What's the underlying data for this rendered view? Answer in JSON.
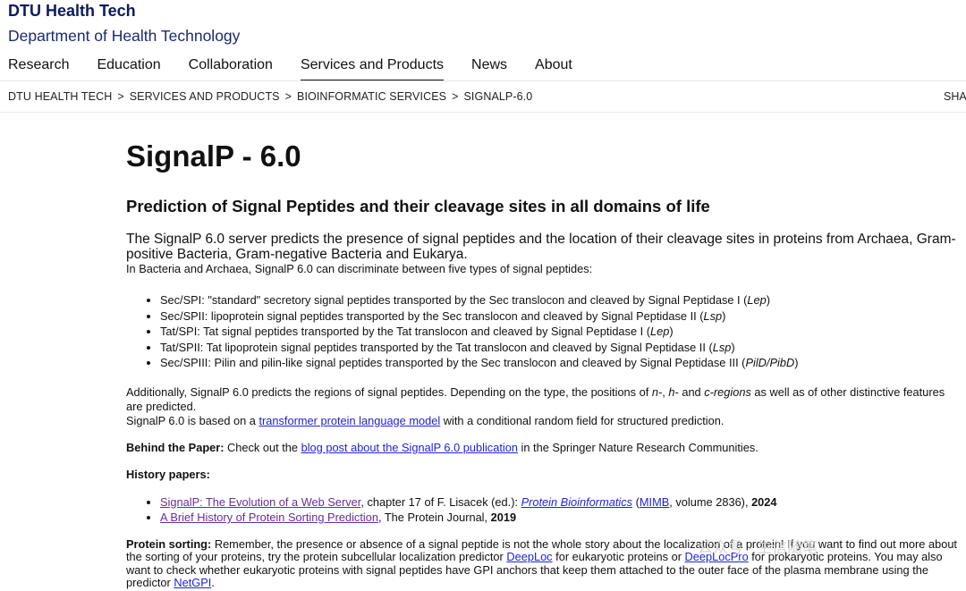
{
  "header": {
    "brand_title": "DTU Health Tech",
    "brand_subtitle": "Department of Health Technology"
  },
  "nav": {
    "items": [
      {
        "label": "Research"
      },
      {
        "label": "Education"
      },
      {
        "label": "Collaboration"
      },
      {
        "label": "Services and Products",
        "active": true
      },
      {
        "label": "News"
      },
      {
        "label": "About"
      }
    ]
  },
  "breadcrumb": {
    "items": [
      "DTU HEALTH TECH",
      "SERVICES AND PRODUCTS",
      "BIOINFORMATIC SERVICES",
      "SIGNALP-6.0"
    ],
    "separator": ">",
    "share_label": "SHA"
  },
  "page": {
    "title": "SignalP - 6.0",
    "subtitle": "Prediction of Signal Peptides and their cleavage sites in all domains of life",
    "lead": "The SignalP 6.0 server predicts the presence of signal peptides and the location of their cleavage sites in proteins from Archaea, Gram-positive Bacteria, Gram-negative Bacteria and Eukarya.",
    "intro": "In Bacteria and Archaea, SignalP 6.0 can discriminate between five types of signal peptides:",
    "types": [
      {
        "text": "Sec/SPI: \"standard\" secretory signal peptides transported by the Sec translocon and cleaved by Signal Peptidase I (",
        "italic": "Lep",
        "end": ")"
      },
      {
        "text": "Sec/SPII: lipoprotein signal peptides transported by the Sec translocon and cleaved by Signal Peptidase II (",
        "italic": "Lsp",
        "end": ")"
      },
      {
        "text": "Tat/SPI: Tat signal peptides transported by the Tat translocon and cleaved by Signal Peptidase I (",
        "italic": "Lep",
        "end": ")"
      },
      {
        "text": "Tat/SPII: Tat lipoprotein signal peptides transported by the Tat translocon and cleaved by Signal Peptidase II (",
        "italic": "Lsp",
        "end": ")"
      },
      {
        "text": "Sec/SPIII: Pilin and pilin-like signal peptides transported by the Sec translocon and cleaved by Signal Peptidase III (",
        "italic": "PilD/PibD",
        "end": ")"
      }
    ],
    "additionally": {
      "pre": "Additionally, SignalP 6.0 predicts the regions of signal peptides. Depending on the type, the positions of ",
      "n": "n-",
      "c1": ", ",
      "h": "h-",
      "c2": " and ",
      "c": "c-regions",
      "post": " as well as of other distinctive features are predicted."
    },
    "based": {
      "pre": "SignalP 6.0 is based on a ",
      "link": "transformer protein language model",
      "post": " with a conditional random field for structured prediction."
    },
    "behind": {
      "label": "Behind the Paper:",
      "pre": " Check out the ",
      "link": "blog post about the SignalP 6.0 publication",
      "post": " in the Springer Nature Research Communities."
    },
    "history_heading": "History papers:",
    "history": [
      {
        "link": "SignalP: The Evolution of a Web Server",
        "mid": ", chapter 17 of F. Lisacek (ed.): ",
        "book_link": "Protein Bioinformatics",
        "paren_open": " (",
        "series_link": "MIMB",
        "series_post": ", volume 2836), ",
        "year": "2024"
      },
      {
        "link": "A Brief History of Protein Sorting Prediction",
        "mid": ", The Protein Journal, ",
        "year": "2019"
      }
    ],
    "sorting": {
      "label": "Protein sorting:",
      "pre": " Remember, the presence or absence of a signal peptide is not the whole story about the localization of a protein! If you want to find out more about the sorting of your proteins, try the protein subcellular localization predictor ",
      "link1": "DeepLoc",
      "mid1": " for eukaryotic proteins or ",
      "link2": "DeepLocPro",
      "mid2": " for prokaryotic proteins. You may also want to check whether eukaryotic proteins with signal peptides have GPI anchors that keep them attached to the outer face of the plasma membrane using the predictor ",
      "link3": "NetGPI",
      "end": "."
    }
  },
  "watermark": "公众号 · 生信随笔"
}
